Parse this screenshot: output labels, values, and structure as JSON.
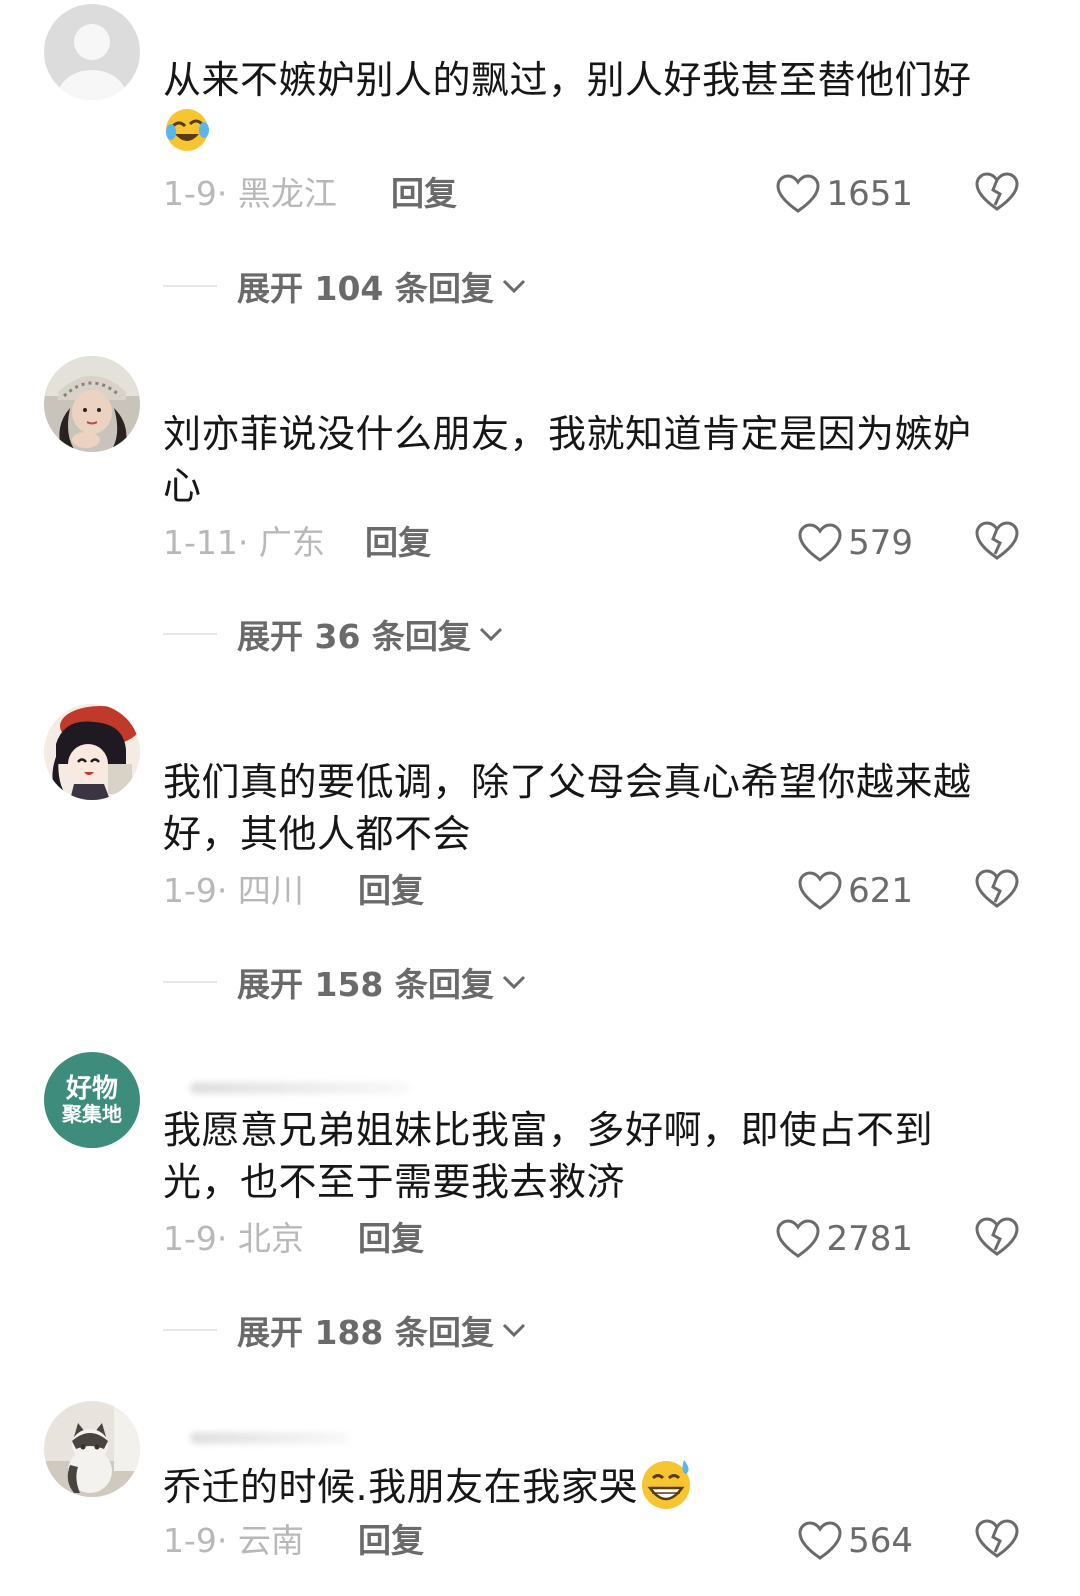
{
  "comments": [
    {
      "avatar": "default-avatar",
      "text": "从来不嫉妒别人的飘过，别人好我甚至替他们好",
      "emoji": "laughing-tears-emoji",
      "date_location": "1-9· 黑龙江",
      "reply_label": "回复",
      "likes": "1651",
      "expand_label": "展开 104 条回复"
    },
    {
      "avatar": "photo-avatar",
      "text": "刘亦菲说没什么朋友，我就知道肯定是因为嫉妒心",
      "date_location": "1-11· 广东",
      "reply_label": "回复",
      "likes": "579",
      "expand_label": "展开 36 条回复"
    },
    {
      "avatar": "cartoon-avatar",
      "text": "我们真的要低调，除了父母会真心希望你越来越好，其他人都不会",
      "date_location": "1-9· 四川",
      "reply_label": "回复",
      "likes": "621",
      "expand_label": "展开 158 条回复"
    },
    {
      "avatar": "brand-avatar",
      "avatar_text_1": "好物",
      "avatar_text_2": "聚集地",
      "text": "我愿意兄弟姐妹比我富，多好啊，即使占不到光，也不至于需要我去救济",
      "date_location": "1-9· 北京",
      "reply_label": "回复",
      "likes": "2781",
      "expand_label": "展开 188 条回复"
    },
    {
      "avatar": "cat-avatar",
      "text": "乔迁的时候.我朋友在我家哭",
      "emoji": "grinning-sweat-emoji",
      "date_location": "1-9· 云南",
      "reply_label": "回复",
      "likes": "564"
    }
  ],
  "colors": {
    "text": "#161616",
    "meta": "#b8b8b8",
    "action": "#6a6a6a",
    "brand_avatar": "#3e8d7c"
  }
}
